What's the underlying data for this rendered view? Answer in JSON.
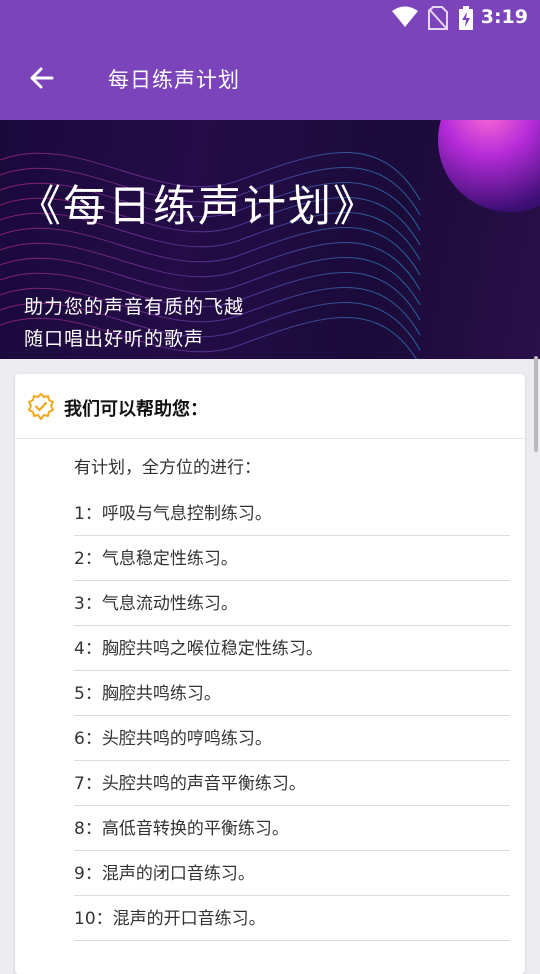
{
  "status_bar": {
    "time": "3:19",
    "icons": [
      "wifi-icon",
      "no-sim-icon",
      "battery-icon"
    ]
  },
  "app_bar": {
    "title": "每日练声计划",
    "back_icon": "arrow-left-icon"
  },
  "banner": {
    "headline": "《每日练声计划》",
    "subtitle_1": "助力您的声音有质的飞越",
    "subtitle_2": "随口唱出好听的歌声"
  },
  "card": {
    "header_icon": "verified-badge-icon",
    "header_text": "我们可以帮助您：",
    "intro": "有计划，全方位的进行：",
    "items": [
      "1：呼吸与气息控制练习。",
      "2：气息稳定性练习。",
      "3：气息流动性练习。",
      "4：胸腔共鸣之喉位稳定性练习。",
      "5：胸腔共鸣练习。",
      "6：头腔共鸣的哼鸣练习。",
      "7：头腔共鸣的声音平衡练习。",
      "8：高低音转换的平衡练习。",
      "9：混声的闭口音练习。",
      "10：混声的开口音练习。"
    ]
  },
  "colors": {
    "primary": "#7b44ba",
    "badge": "#f0a91e",
    "banner_dark": "#1a0a3c"
  }
}
